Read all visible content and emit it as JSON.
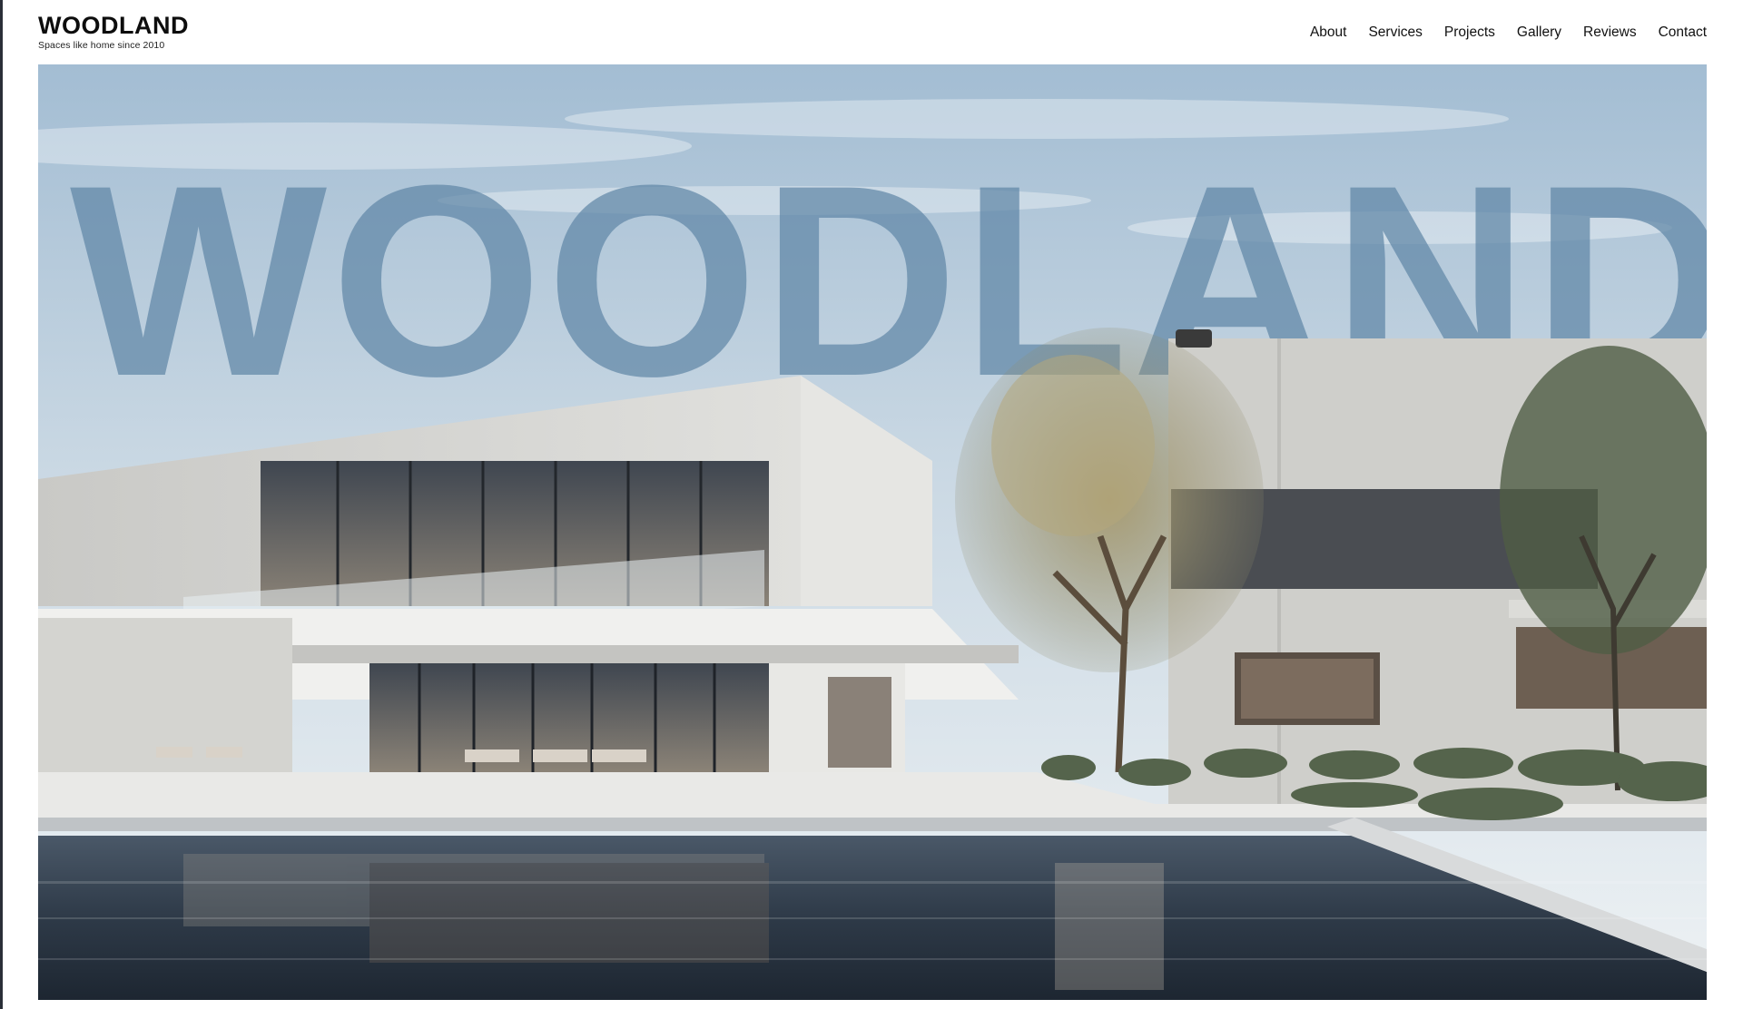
{
  "brand": {
    "name": "WOODLAND",
    "tagline": "Spaces like home since 2010"
  },
  "nav": {
    "items": [
      {
        "label": "About"
      },
      {
        "label": "Services"
      },
      {
        "label": "Projects"
      },
      {
        "label": "Gallery"
      },
      {
        "label": "Reviews"
      },
      {
        "label": "Contact"
      }
    ]
  },
  "hero": {
    "title": "WOODLAND",
    "image_description": "modern-house-with-pool-photo"
  },
  "colors": {
    "sky_top": "#a9c1d6",
    "sky_bottom": "#e9eef2",
    "title_overlay": "#5f87a6",
    "facade": "#dcdcd8",
    "pool": "#2d3a4a"
  }
}
